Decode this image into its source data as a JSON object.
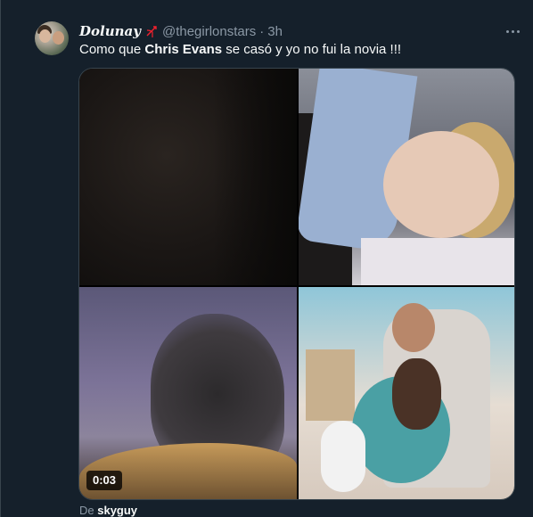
{
  "tweet": {
    "display_name": "Dolunay",
    "badge_icon": "bow-and-arrow-icon",
    "handle": "@thegirlonstars",
    "separator": "·",
    "timestamp": "3h",
    "text_before": "Como que ",
    "text_bold": "Chris Evans",
    "text_after": " se casó y yo no fui la novia !!!",
    "more_icon": "more-dots-icon"
  },
  "media": {
    "duration": "0:03"
  },
  "attribution": {
    "prefix": "De ",
    "source": "skyguy"
  },
  "colors": {
    "background": "#15202b",
    "text": "#f7f9f9",
    "secondary_text": "#8b98a5",
    "accent": "#1d9bf0",
    "badge": "#f4212e"
  }
}
